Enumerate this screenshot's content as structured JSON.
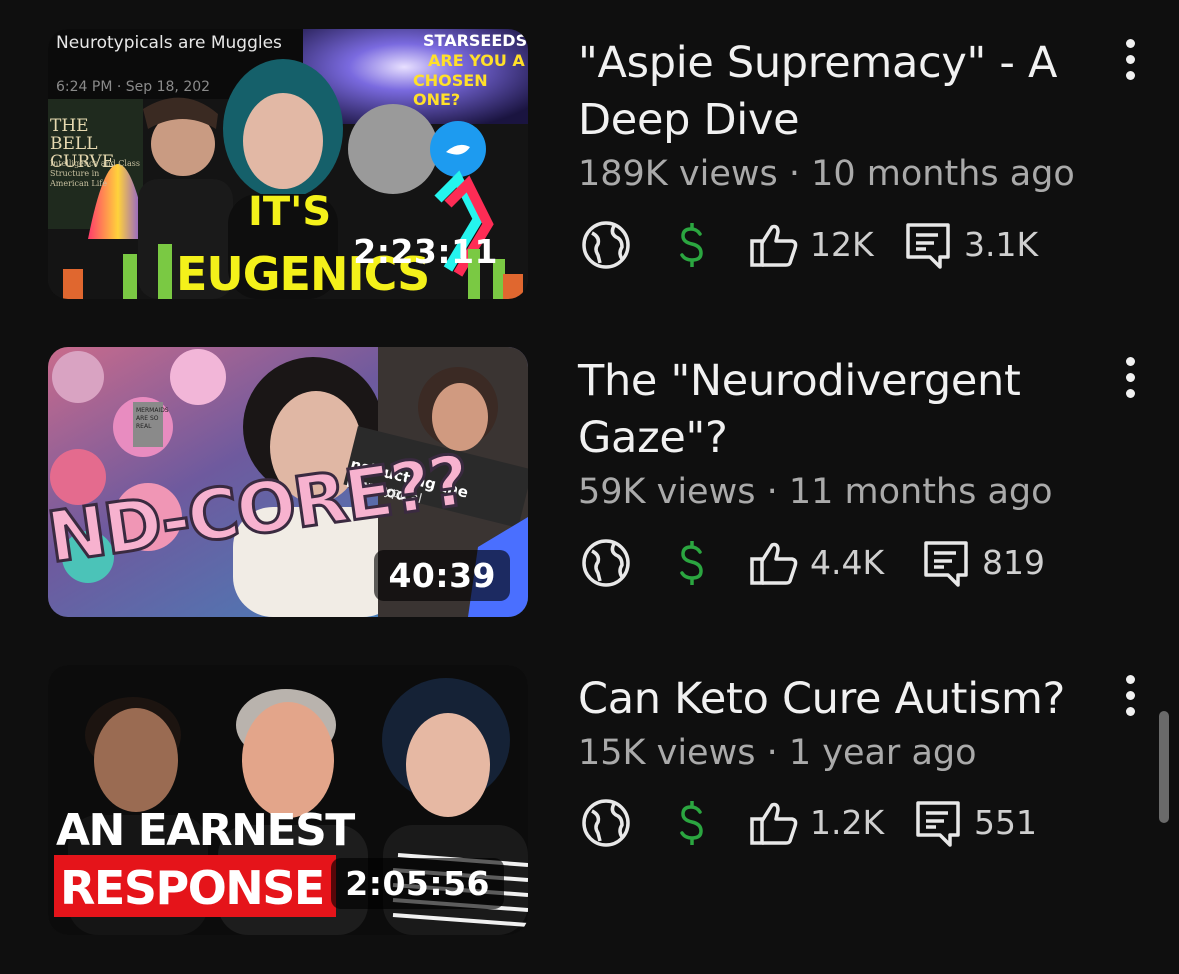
{
  "videos": [
    {
      "title": "\"Aspie Supremacy\" - A Deep Dive",
      "views": "189K views",
      "age": "10 months ago",
      "meta_separator": " · ",
      "duration": "2:23:11",
      "likes": "12K",
      "comments": "3.1K",
      "thumb": {
        "tweet_header": "Neurotypicals are Muggles",
        "tweet_time": "6:24 PM · Sep 18, 202",
        "book_title": "THE BELL CURVE",
        "book_subtitle": "Intelligence and Class Structure in American Life",
        "starseeds_1": "STARSEEDS",
        "starseeds_2": "ARE YOU A",
        "starseeds_3": "CHOSEN ONE?",
        "caption_1": "IT'S",
        "caption_2": "EUGENICS"
      }
    },
    {
      "title": "The \"Neurodivergent Gaze\"?",
      "views": "59K views",
      "age": "11 months ago",
      "meta_separator": " · ",
      "duration": "40:39",
      "likes": "4.4K",
      "comments": "819",
      "thumb": {
        "caption": "ND-CORE??",
        "strip_text": "nstructing the Neurod",
        "strip_text_2": "eurotypical",
        "sign_text": "MERMAIDS ARE SO REAL"
      }
    },
    {
      "title": "Can Keto Cure Autism?",
      "views": "15K views",
      "age": "1 year ago",
      "meta_separator": " · ",
      "duration": "2:05:56",
      "likes": "1.2K",
      "comments": "551",
      "thumb": {
        "caption_1": "AN EARNEST",
        "caption_2": "RESPONSE"
      }
    }
  ],
  "icons": {
    "visibility": "globe-icon",
    "monetization": "dollar-icon",
    "likes": "thumbs-up-icon",
    "comments": "comment-icon",
    "menu": "more-vertical-icon"
  },
  "colors": {
    "background": "#0f0f0f",
    "monetized_green": "#2ba640",
    "text_primary": "#f1f1f1",
    "text_secondary": "#aaaaaa"
  }
}
